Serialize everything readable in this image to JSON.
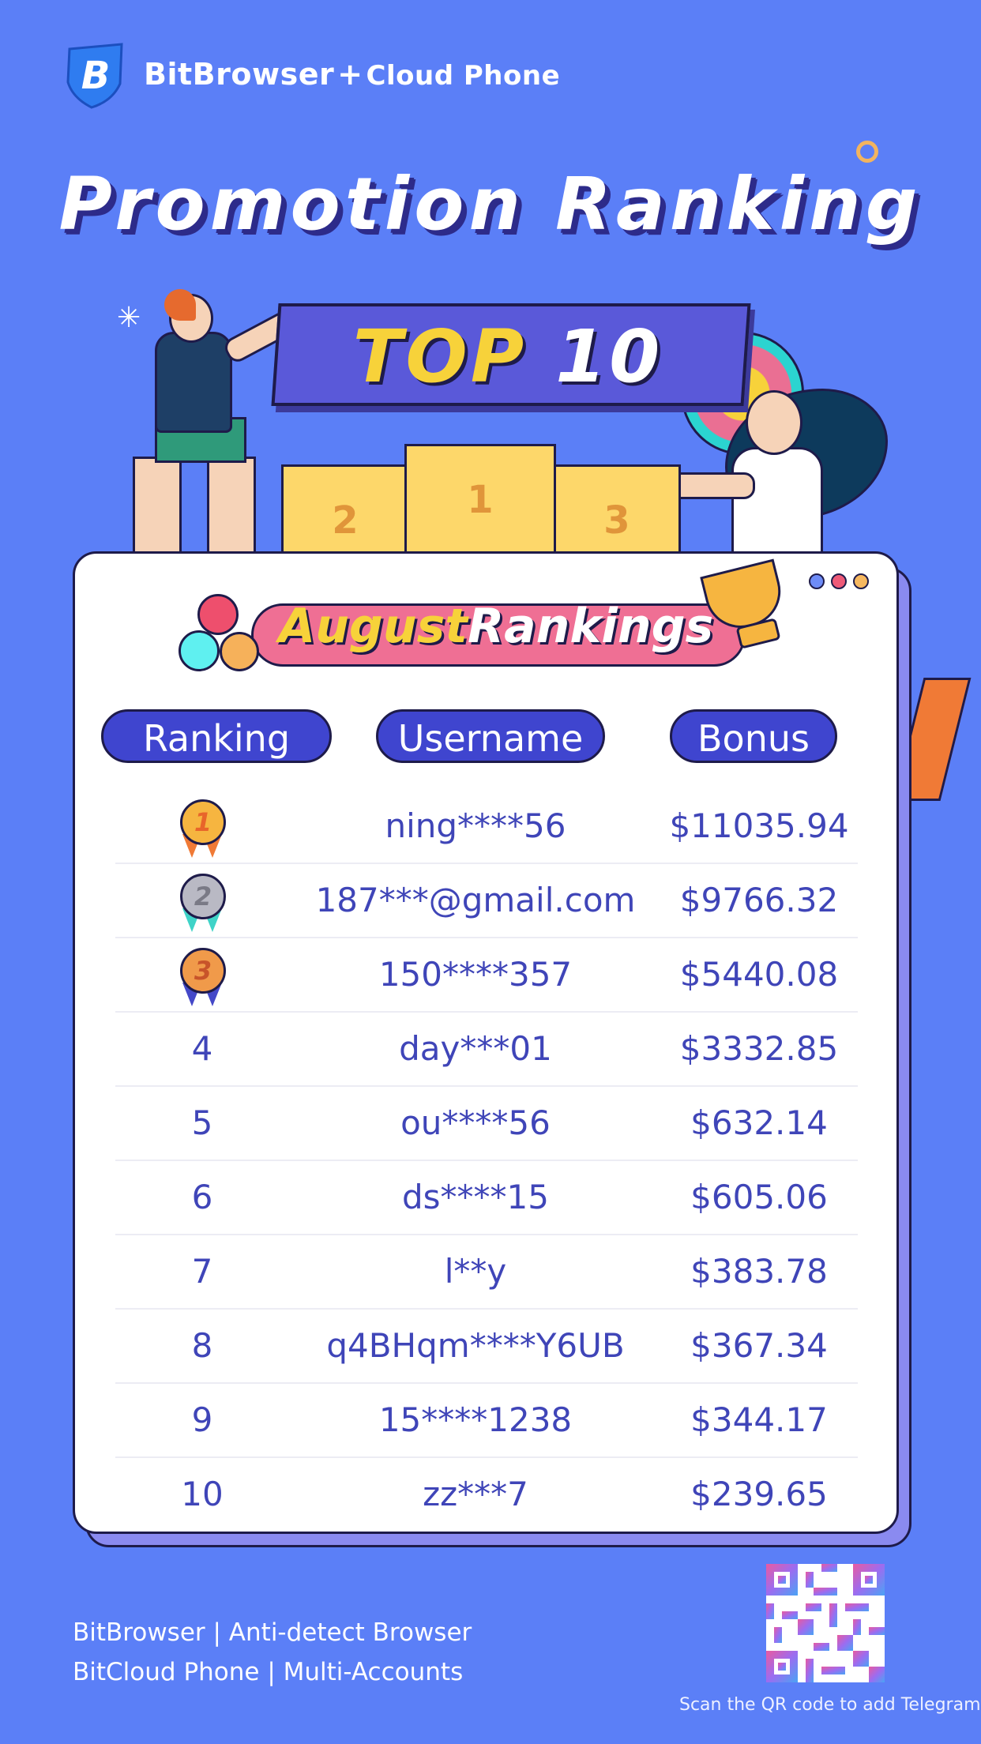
{
  "header": {
    "brand_main": "BitBrowser",
    "brand_plus": "+",
    "brand_sub": "Cloud Phone",
    "title": "Promotion Ranking"
  },
  "banner": {
    "top": "TOP",
    "ten": "10"
  },
  "podium": {
    "first": "1",
    "second": "2",
    "third": "3"
  },
  "card": {
    "month": "August",
    "rankings_word": "Rankings",
    "columns": {
      "ranking": "Ranking",
      "username": "Username",
      "bonus": "Bonus"
    },
    "rows": [
      {
        "rank": "1",
        "username": "ning****56",
        "bonus": "$11035.94",
        "medal": "gold"
      },
      {
        "rank": "2",
        "username": "187***@gmail.com",
        "bonus": "$9766.32",
        "medal": "silver"
      },
      {
        "rank": "3",
        "username": "150****357",
        "bonus": "$5440.08",
        "medal": "bronze"
      },
      {
        "rank": "4",
        "username": "day***01",
        "bonus": "$3332.85"
      },
      {
        "rank": "5",
        "username": "ou****56",
        "bonus": "$632.14"
      },
      {
        "rank": "6",
        "username": "ds****15",
        "bonus": "$605.06"
      },
      {
        "rank": "7",
        "username": "l**y",
        "bonus": "$383.78"
      },
      {
        "rank": "8",
        "username": "q4BHqm****Y6UB",
        "bonus": "$367.34"
      },
      {
        "rank": "9",
        "username": "15****1238",
        "bonus": "$344.17"
      },
      {
        "rank": "10",
        "username": "zz***7",
        "bonus": "$239.65"
      }
    ]
  },
  "footer": {
    "line1": "BitBrowser | Anti-detect Browser",
    "line2": "BitCloud Phone | Multi-Accounts",
    "qr_caption": "Scan the QR code to add Telegram"
  },
  "colors": {
    "background": "#5b7ff7",
    "accent_header": "#3f45cf",
    "row_text": "#3f45b8",
    "gold_medal": "#f6b540",
    "silver_medal": "#b9b9c4",
    "bronze_medal": "#f09a4a"
  }
}
